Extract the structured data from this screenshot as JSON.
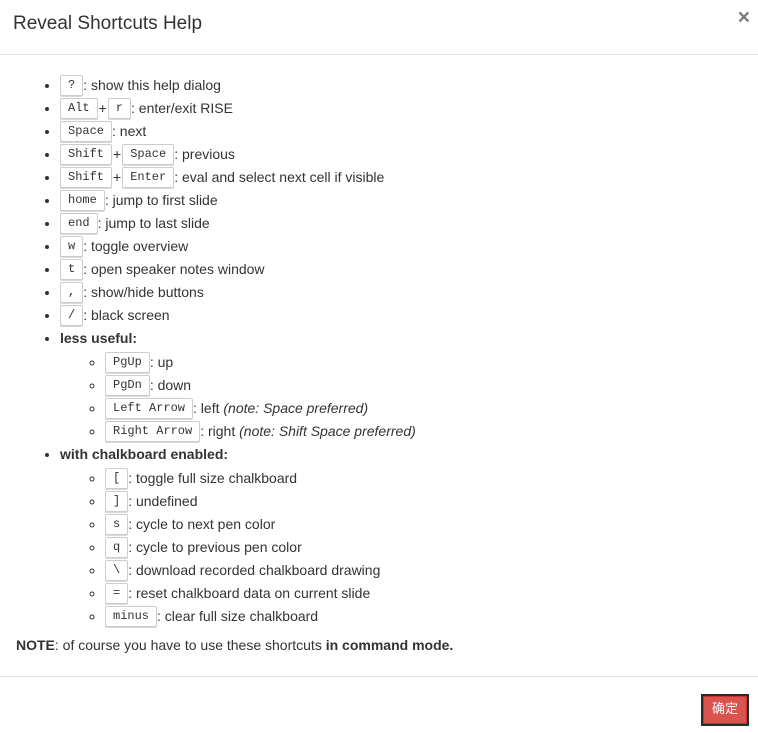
{
  "dialog": {
    "title": "Reveal Shortcuts Help",
    "close_glyph": "×",
    "ok_label": "确定"
  },
  "shortcuts": [
    {
      "keys": [
        "?"
      ],
      "desc": ": show this help dialog"
    },
    {
      "keys": [
        "Alt",
        "r"
      ],
      "desc": ": enter/exit RISE"
    },
    {
      "keys": [
        "Space"
      ],
      "desc": ": next"
    },
    {
      "keys": [
        "Shift",
        "Space"
      ],
      "desc": ": previous"
    },
    {
      "keys": [
        "Shift",
        "Enter"
      ],
      "desc": ": eval and select next cell if visible"
    },
    {
      "keys": [
        "home"
      ],
      "desc": ": jump to first slide"
    },
    {
      "keys": [
        "end"
      ],
      "desc": ": jump to last slide"
    },
    {
      "keys": [
        "w"
      ],
      "desc": ": toggle overview"
    },
    {
      "keys": [
        "t"
      ],
      "desc": ": open speaker notes window"
    },
    {
      "keys": [
        ","
      ],
      "desc": ": show/hide buttons"
    },
    {
      "keys": [
        "/"
      ],
      "desc": ": black screen"
    }
  ],
  "less_useful": {
    "label": "less useful:",
    "items": [
      {
        "keys": [
          "PgUp"
        ],
        "desc": ": up",
        "note": ""
      },
      {
        "keys": [
          "PgDn"
        ],
        "desc": ": down",
        "note": ""
      },
      {
        "keys": [
          "Left Arrow"
        ],
        "desc": ": left ",
        "note": "(note: Space preferred)"
      },
      {
        "keys": [
          "Right Arrow"
        ],
        "desc": ": right ",
        "note": "(note: Shift Space preferred)"
      }
    ]
  },
  "chalkboard": {
    "label": "with chalkboard enabled:",
    "items": [
      {
        "keys": [
          "["
        ],
        "desc": ": toggle full size chalkboard"
      },
      {
        "keys": [
          "]"
        ],
        "desc": ": undefined"
      },
      {
        "keys": [
          "s"
        ],
        "desc": ": cycle to next pen color"
      },
      {
        "keys": [
          "q"
        ],
        "desc": ": cycle to previous pen color"
      },
      {
        "keys": [
          "\\"
        ],
        "desc": ": download recorded chalkboard drawing"
      },
      {
        "keys": [
          "="
        ],
        "desc": ": reset chalkboard data on current slide"
      },
      {
        "keys": [
          "minus"
        ],
        "desc": ": clear full size chalkboard"
      }
    ]
  },
  "note": {
    "label": "NOTE",
    "text": ": of course you have to use these shortcuts ",
    "emphasis": "in command mode."
  },
  "colors": {
    "ok_button": "#d9534f",
    "text": "#333333"
  }
}
